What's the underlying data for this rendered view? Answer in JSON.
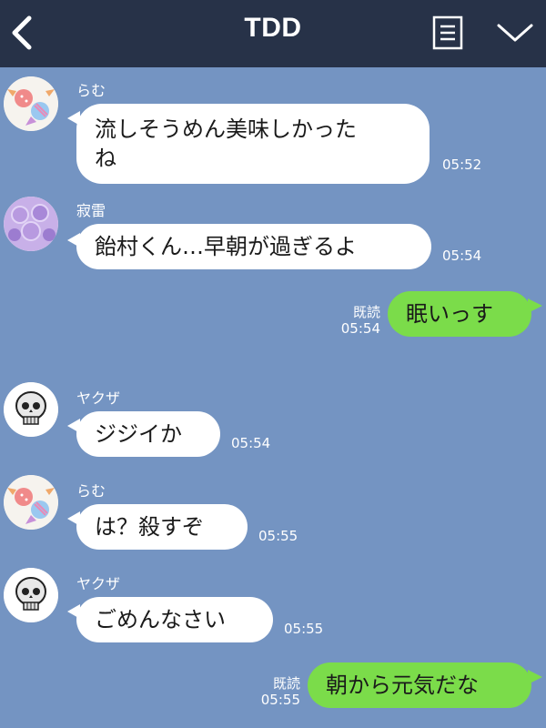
{
  "header": {
    "title": "TDD",
    "back_icon": "chevron-left-icon",
    "menu_icon": "notes-icon",
    "expand_icon": "chevron-down-icon"
  },
  "colors": {
    "header_bg": "#273248",
    "chat_bg": "#7494c2",
    "bubble_left": "#ffffff",
    "bubble_right": "#7bdc4a"
  },
  "messages": [
    {
      "side": "left",
      "sender": "らむ",
      "avatar": "candy-avatar",
      "lines": [
        "流しそうめん美味しかった",
        "ね"
      ],
      "time": "05:52"
    },
    {
      "side": "left",
      "sender": "寂雷",
      "avatar": "pills-avatar",
      "lines": [
        "飴村くん…早朝が過ぎるよ"
      ],
      "time": "05:54"
    },
    {
      "side": "right",
      "read": "既読",
      "lines": [
        "眠いっす"
      ],
      "time": "05:54"
    },
    {
      "side": "left",
      "sender": "ヤクザ",
      "avatar": "skull-avatar",
      "lines": [
        "ジジイか"
      ],
      "time": "05:54"
    },
    {
      "side": "left",
      "sender": "らむ",
      "avatar": "candy-avatar",
      "lines": [
        "は？殺すぞ"
      ],
      "time": "05:55"
    },
    {
      "side": "left",
      "sender": "ヤクザ",
      "avatar": "skull-avatar",
      "lines": [
        "ごめんなさい"
      ],
      "time": "05:55"
    },
    {
      "side": "right",
      "read": "既読",
      "lines": [
        "朝から元気だな"
      ],
      "time": "05:55"
    }
  ]
}
